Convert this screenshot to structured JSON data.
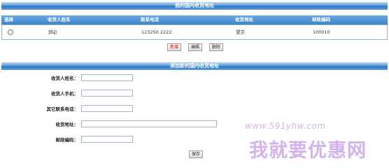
{
  "list_section": {
    "title": "我的国内收货地址",
    "columns": [
      "选择",
      "收货人姓名",
      "联系电话",
      "收货地址",
      "邮政编码"
    ],
    "rows": [
      {
        "name": "邱必",
        "phone": "123250.2222",
        "address": "望京",
        "postcode": "100010"
      }
    ],
    "buttons": {
      "add": "新增",
      "edit": "编辑",
      "delete": "删除"
    }
  },
  "add_section": {
    "title": "添加新的国内收货地址",
    "fields": [
      {
        "label": "收货人姓名：",
        "value": ""
      },
      {
        "label": "收货人手机：",
        "value": ""
      },
      {
        "label": "其它联系电话：",
        "value": ""
      },
      {
        "label": "收货地址：",
        "value": ""
      },
      {
        "label": "邮政编码：",
        "value": ""
      }
    ],
    "save_label": "保存"
  },
  "watermark": {
    "url": "www.591yhw.com",
    "text": "我就要优惠网"
  },
  "colors": {
    "header_blue": "#3f83c8",
    "accent_red": "#e00000",
    "watermark": "#d4b2ee"
  }
}
